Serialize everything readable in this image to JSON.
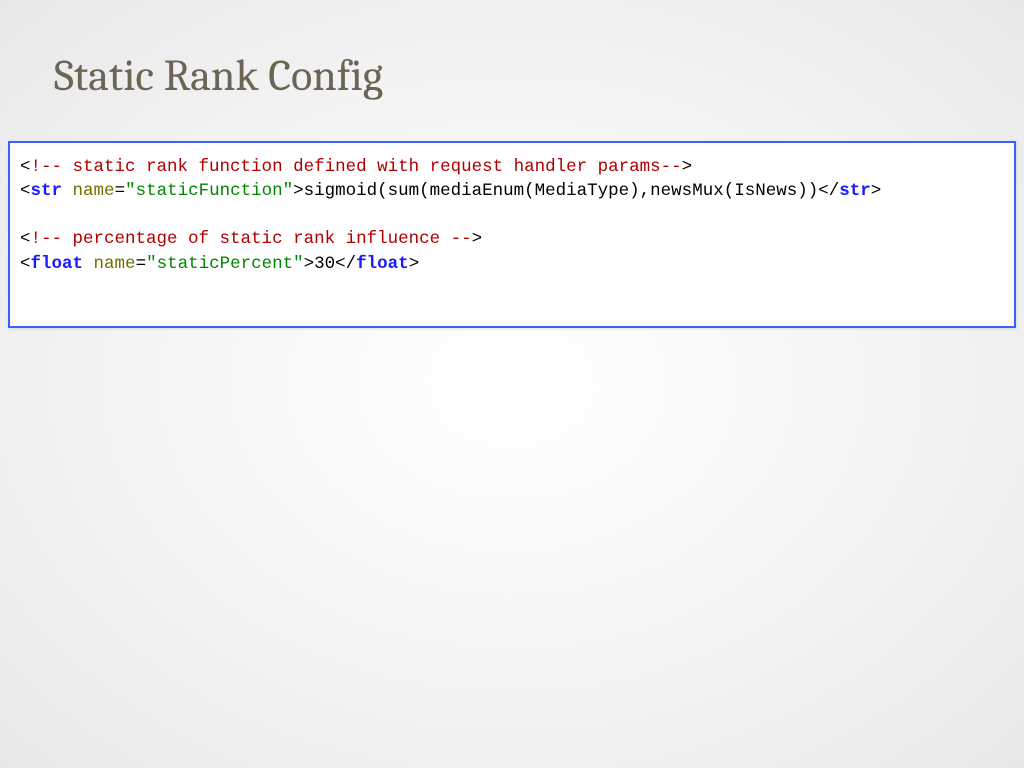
{
  "title": "Static Rank Config",
  "code": {
    "line1": {
      "lt": "<",
      "bang_open": "!-- ",
      "comment_text": "static rank function defined with request handler params",
      "bang_close": "--",
      "gt": ">"
    },
    "line2": {
      "lt": "<",
      "tag": "str",
      "space": " ",
      "attr_name": "name",
      "eq": "=",
      "attr_val": "\"staticFunction\"",
      "gt1": ">",
      "content": "sigmoid(sum(mediaEnum(MediaType),newsMux(IsNews))",
      "lt2": "<",
      "slash": "/",
      "tag2": "str",
      "gt2": ">"
    },
    "line4": {
      "lt": "<",
      "bang_open": "!-- ",
      "comment_text": "percentage of static rank influence ",
      "bang_close": "--",
      "gt": ">"
    },
    "line5": {
      "lt": "<",
      "tag": "float",
      "space": " ",
      "attr_name": "name",
      "eq": "=",
      "attr_val": "\"staticPercent\"",
      "gt1": ">",
      "content": "30",
      "lt2": "<",
      "slash": "/",
      "tag2": "float",
      "gt2": ">"
    }
  }
}
